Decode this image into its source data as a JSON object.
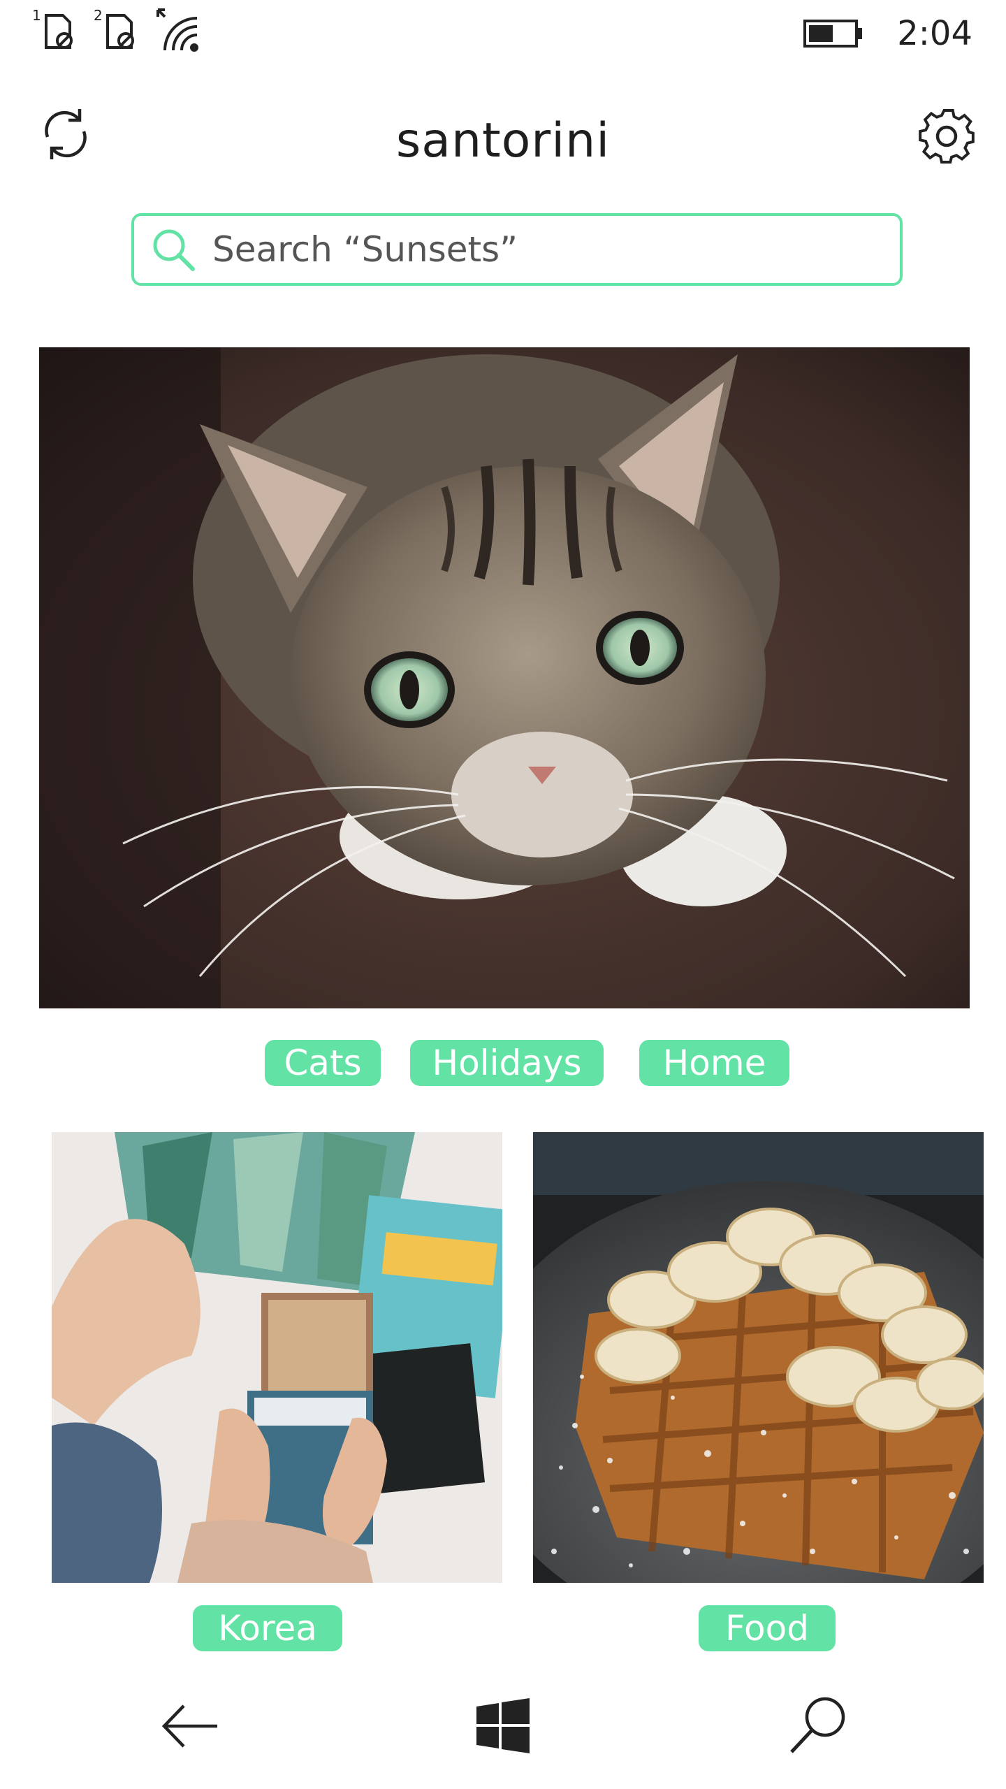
{
  "status_bar": {
    "sim1_slot": "1",
    "sim2_slot": "2",
    "time": "2:04",
    "icons": [
      "sim-no-service-icon",
      "sim-no-service-icon",
      "wifi-icon",
      "battery-icon"
    ]
  },
  "header": {
    "title": "santorini",
    "left_icon": "sync-icon",
    "right_icon": "gear-icon"
  },
  "search": {
    "placeholder": "Search “Sunsets”",
    "icon": "search-icon"
  },
  "accent_color": "#63e2a5",
  "featured": {
    "image": "cat-photo",
    "tags": [
      "Cats",
      "Holidays",
      "Home"
    ]
  },
  "grid": [
    {
      "image": "magazines-photo",
      "tag": "Korea"
    },
    {
      "image": "waffle-photo",
      "tag": "Food"
    }
  ],
  "nav": {
    "icons": [
      "back-arrow-icon",
      "windows-logo-icon",
      "search-icon"
    ]
  }
}
